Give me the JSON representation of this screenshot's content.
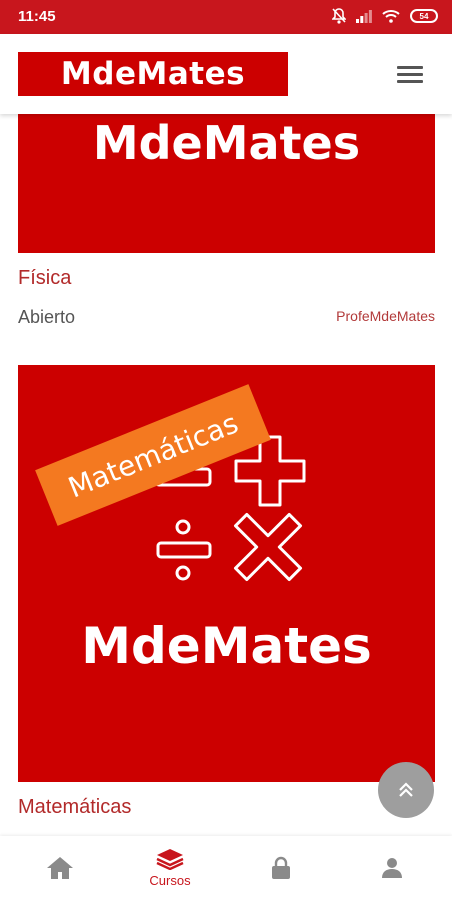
{
  "status_bar": {
    "time": "11:45",
    "battery": "54"
  },
  "header": {
    "logo_text": "MdeMates"
  },
  "courses": [
    {
      "banner_text": "MdeMates",
      "title": "Física",
      "status": "Abierto",
      "teacher": "ProfeMdeMates"
    },
    {
      "banner_text": "MdeMates",
      "ribbon_text": "Matemáticas",
      "title": "Matemáticas"
    }
  ],
  "bottom_nav": [
    {
      "icon": "home-icon",
      "label": ""
    },
    {
      "icon": "courses-stack-icon",
      "label": "Cursos",
      "active": true
    },
    {
      "icon": "lock-icon",
      "label": ""
    },
    {
      "icon": "user-icon",
      "label": ""
    }
  ],
  "colors": {
    "brand_red": "#cc0000",
    "status_red": "#c8161d",
    "ribbon_orange": "#f47920",
    "fab_gray": "#9e9e9e"
  }
}
